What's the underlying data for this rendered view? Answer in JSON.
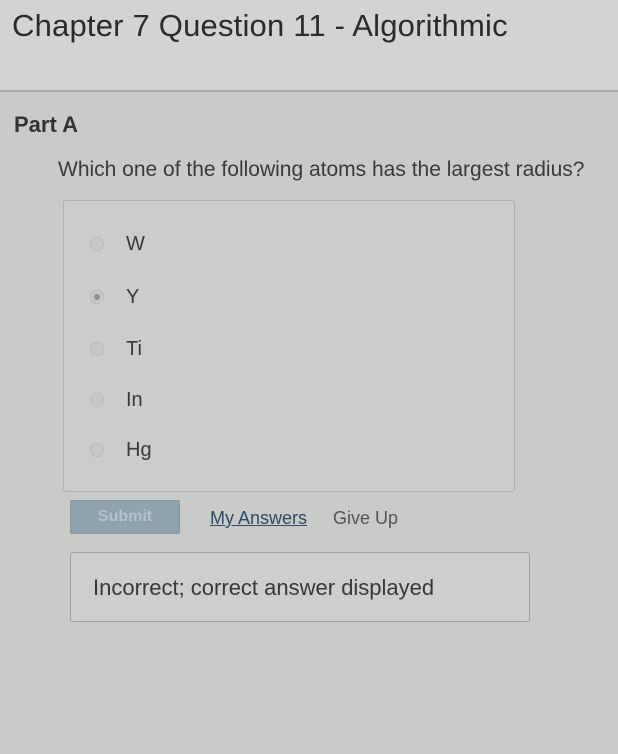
{
  "header": {
    "title": "Chapter 7 Question 11 - Algorithmic"
  },
  "part": {
    "label": "Part A",
    "question": "Which one of the following atoms has the largest radius?",
    "choices": [
      {
        "label": "W",
        "selected": false
      },
      {
        "label": "Y",
        "selected": true
      },
      {
        "label": "Ti",
        "selected": false
      },
      {
        "label": "In",
        "selected": false
      },
      {
        "label": "Hg",
        "selected": false
      }
    ]
  },
  "actions": {
    "submit_label": "Submit",
    "my_answers_label": "My Answers",
    "give_up_label": "Give Up"
  },
  "feedback": {
    "message": "Incorrect; correct answer displayed"
  }
}
